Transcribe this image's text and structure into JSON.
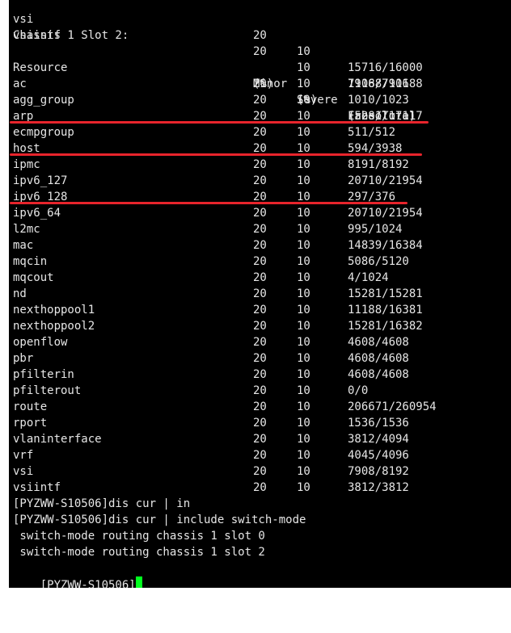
{
  "top_rows": [
    {
      "name": "vsi",
      "minor": "20",
      "severe": "10",
      "free_total": "15716/16000"
    },
    {
      "name": "vsiintf",
      "minor": "20",
      "severe": "10",
      "free_total": "7906/7906"
    }
  ],
  "section_title": "Chassis 1 Slot 2:",
  "headers": {
    "resource": "Resource",
    "minor": "Minor",
    "minor_unit": "(%)",
    "severe": "Severe",
    "severe_unit": "(%)",
    "free_total": "Free/Total",
    "free_total_unit": "(absolute)"
  },
  "rows": [
    {
      "name": "ac",
      "minor": "20",
      "severe": "10",
      "free_total": "11188/11188"
    },
    {
      "name": "agg_group",
      "minor": "20",
      "severe": "10",
      "free_total": "1010/1023"
    },
    {
      "name": "arp",
      "minor": "20",
      "severe": "10",
      "free_total": "15281/17117"
    },
    {
      "name": "ecmpgroup",
      "minor": "20",
      "severe": "10",
      "free_total": "511/512"
    },
    {
      "name": "host",
      "minor": "20",
      "severe": "10",
      "free_total": "594/3938"
    },
    {
      "name": "ipmc",
      "minor": "20",
      "severe": "10",
      "free_total": "8191/8192"
    },
    {
      "name": "ipv6_127",
      "minor": "20",
      "severe": "10",
      "free_total": "20710/21954"
    },
    {
      "name": "ipv6_128",
      "minor": "20",
      "severe": "10",
      "free_total": "297/376"
    },
    {
      "name": "ipv6_64",
      "minor": "20",
      "severe": "10",
      "free_total": "20710/21954"
    },
    {
      "name": "l2mc",
      "minor": "20",
      "severe": "10",
      "free_total": "995/1024"
    },
    {
      "name": "mac",
      "minor": "20",
      "severe": "10",
      "free_total": "14839/16384"
    },
    {
      "name": "mqcin",
      "minor": "20",
      "severe": "10",
      "free_total": "5086/5120"
    },
    {
      "name": "mqcout",
      "minor": "20",
      "severe": "10",
      "free_total": "4/1024"
    },
    {
      "name": "nd",
      "minor": "20",
      "severe": "10",
      "free_total": "15281/15281"
    },
    {
      "name": "nexthoppool1",
      "minor": "20",
      "severe": "10",
      "free_total": "11188/16381"
    },
    {
      "name": "nexthoppool2",
      "minor": "20",
      "severe": "10",
      "free_total": "15281/16382"
    },
    {
      "name": "openflow",
      "minor": "20",
      "severe": "10",
      "free_total": "4608/4608"
    },
    {
      "name": "pbr",
      "minor": "20",
      "severe": "10",
      "free_total": "4608/4608"
    },
    {
      "name": "pfilterin",
      "minor": "20",
      "severe": "10",
      "free_total": "4608/4608"
    },
    {
      "name": "pfilterout",
      "minor": "20",
      "severe": "10",
      "free_total": "0/0"
    },
    {
      "name": "route",
      "minor": "20",
      "severe": "10",
      "free_total": "206671/260954"
    },
    {
      "name": "rport",
      "minor": "20",
      "severe": "10",
      "free_total": "1536/1536"
    },
    {
      "name": "vlaninterface",
      "minor": "20",
      "severe": "10",
      "free_total": "3812/4094"
    },
    {
      "name": "vrf",
      "minor": "20",
      "severe": "10",
      "free_total": "4045/4096"
    },
    {
      "name": "vsi",
      "minor": "20",
      "severe": "10",
      "free_total": "7908/8192"
    },
    {
      "name": "vsiintf",
      "minor": "20",
      "severe": "10",
      "free_total": "3812/3812"
    }
  ],
  "console_lines": [
    "[PYZWW-S10506]dis cur | in",
    "[PYZWW-S10506]dis cur | include switch-mode",
    " switch-mode routing chassis 1 slot 0",
    " switch-mode routing chassis 1 slot 2"
  ],
  "prompt": "[PYZWW-S10506]",
  "highlight_color": "#e8242c",
  "cursor_color": "#00ff1e"
}
